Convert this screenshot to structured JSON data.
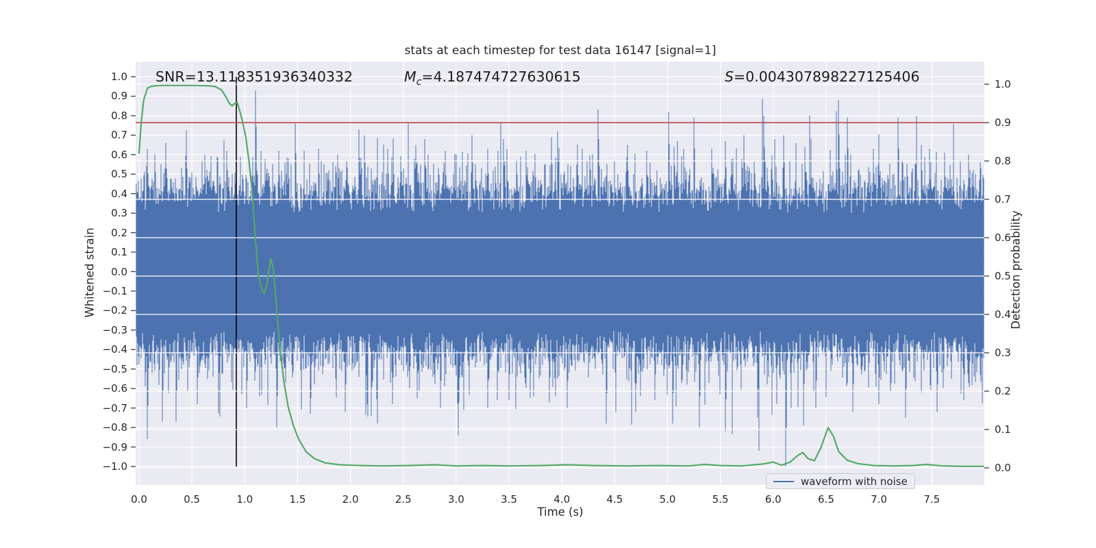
{
  "figure": {
    "background": "#ffffff"
  },
  "chart_data": {
    "type": "line",
    "title": "stats at each timestep for test data 16147 [signal=1]",
    "xlabel": "Time (s)",
    "ylabel_left": "Whitened strain",
    "ylabel_right": "Detection probability",
    "xlim": [
      -0.04,
      8.0
    ],
    "ylim_left": [
      -1.095,
      1.075
    ],
    "ylim_right": [
      -0.045,
      1.06
    ],
    "grid": true,
    "colors": {
      "waveform": "#4c72b0",
      "probability": "#55a868",
      "threshold": "#c44e52",
      "event_marker": "#000000",
      "axes_background": "#eaeaf2",
      "gridline": "#ffffff",
      "text": "#262626"
    },
    "annotations": [
      {
        "sym": "SNR",
        "sub": "",
        "eq": "=13.118351936340332",
        "italic": false
      },
      {
        "sym": "M",
        "sub": "c",
        "eq": "=4.187474727630615",
        "italic": true
      },
      {
        "sym": "S",
        "sub": "",
        "eq": "=0.004307898227125406",
        "italic": true
      }
    ],
    "x_ticks": [
      {
        "v": 0.0,
        "label": "0.0"
      },
      {
        "v": 0.5,
        "label": "0.5"
      },
      {
        "v": 1.0,
        "label": "1.0"
      },
      {
        "v": 1.5,
        "label": "1.5"
      },
      {
        "v": 2.0,
        "label": "2.0"
      },
      {
        "v": 2.5,
        "label": "2.5"
      },
      {
        "v": 3.0,
        "label": "3.0"
      },
      {
        "v": 3.5,
        "label": "3.5"
      },
      {
        "v": 4.0,
        "label": "4.0"
      },
      {
        "v": 4.5,
        "label": "4.5"
      },
      {
        "v": 5.0,
        "label": "5.0"
      },
      {
        "v": 5.5,
        "label": "5.5"
      },
      {
        "v": 6.0,
        "label": "6.0"
      },
      {
        "v": 6.5,
        "label": "6.5"
      },
      {
        "v": 7.0,
        "label": "7.0"
      },
      {
        "v": 7.5,
        "label": "7.5"
      }
    ],
    "y_ticks_left": [
      {
        "v": 1.0,
        "label": "1.0"
      },
      {
        "v": 0.9,
        "label": "0.9"
      },
      {
        "v": 0.8,
        "label": "0.8"
      },
      {
        "v": 0.7,
        "label": "0.7"
      },
      {
        "v": 0.6,
        "label": "0.6"
      },
      {
        "v": 0.5,
        "label": "0.5"
      },
      {
        "v": 0.4,
        "label": "0.4"
      },
      {
        "v": 0.3,
        "label": "0.3"
      },
      {
        "v": 0.2,
        "label": "0.2"
      },
      {
        "v": 0.1,
        "label": "0.1"
      },
      {
        "v": 0.0,
        "label": "0.0"
      },
      {
        "v": -0.1,
        "label": "−0.1"
      },
      {
        "v": -0.2,
        "label": "−0.2"
      },
      {
        "v": -0.3,
        "label": "−0.3"
      },
      {
        "v": -0.4,
        "label": "−0.4"
      },
      {
        "v": -0.5,
        "label": "−0.5"
      },
      {
        "v": -0.6,
        "label": "−0.6"
      },
      {
        "v": -0.7,
        "label": "−0.7"
      },
      {
        "v": -0.8,
        "label": "−0.8"
      },
      {
        "v": -0.9,
        "label": "−0.9"
      },
      {
        "v": -1.0,
        "label": "−1.0"
      }
    ],
    "y_ticks_right": [
      {
        "v": 1.0,
        "label": "1.0"
      },
      {
        "v": 0.9,
        "label": "0.9"
      },
      {
        "v": 0.8,
        "label": "0.8"
      },
      {
        "v": 0.7,
        "label": "0.7"
      },
      {
        "v": 0.6,
        "label": "0.6"
      },
      {
        "v": 0.5,
        "label": "0.5"
      },
      {
        "v": 0.4,
        "label": "0.4"
      },
      {
        "v": 0.3,
        "label": "0.3"
      },
      {
        "v": 0.2,
        "label": "0.2"
      },
      {
        "v": 0.1,
        "label": "0.1"
      },
      {
        "v": 0.0,
        "label": "0.0"
      }
    ],
    "threshold_line": {
      "axis": "right",
      "value": 0.9
    },
    "event_line": {
      "x": 0.92,
      "span_strain": [
        -1.0,
        1.0
      ]
    },
    "legend": {
      "entries": [
        {
          "label": "waveform with noise",
          "color": "#4c72b0"
        }
      ],
      "position": "lower right"
    },
    "series": [
      {
        "name": "waveform with noise",
        "axis": "left",
        "kind": "noise-envelope",
        "seed": 20147,
        "core_band": 0.31,
        "typical_peak": 0.52,
        "spikes_up": [
          [
            0.08,
            0.63
          ],
          [
            0.25,
            0.66
          ],
          [
            0.45,
            0.66
          ],
          [
            0.62,
            0.6
          ],
          [
            0.83,
            0.62
          ],
          [
            1.1,
            0.93
          ],
          [
            1.32,
            0.62
          ],
          [
            1.48,
            0.76
          ],
          [
            1.7,
            0.63
          ],
          [
            1.88,
            0.6
          ],
          [
            2.08,
            0.73
          ],
          [
            2.13,
            0.7
          ],
          [
            2.35,
            0.63
          ],
          [
            2.62,
            0.65
          ],
          [
            2.7,
            0.68
          ],
          [
            2.9,
            0.62
          ],
          [
            3.15,
            0.7
          ],
          [
            3.3,
            0.63
          ],
          [
            3.45,
            0.68
          ],
          [
            3.66,
            0.62
          ],
          [
            3.9,
            0.69
          ],
          [
            3.96,
            0.72
          ],
          [
            4.15,
            0.62
          ],
          [
            4.35,
            0.68
          ],
          [
            4.62,
            0.65
          ],
          [
            4.8,
            0.62
          ],
          [
            5.01,
            0.82
          ],
          [
            5.25,
            0.79
          ],
          [
            5.42,
            0.63
          ],
          [
            5.55,
            0.67
          ],
          [
            5.72,
            0.7
          ],
          [
            5.91,
            0.8
          ],
          [
            6.1,
            0.7
          ],
          [
            6.3,
            0.64
          ],
          [
            6.62,
            0.88
          ],
          [
            6.7,
            0.79
          ],
          [
            6.95,
            0.63
          ],
          [
            7.18,
            0.79
          ],
          [
            7.4,
            0.65
          ],
          [
            7.62,
            0.61
          ],
          [
            7.85,
            0.6
          ]
        ],
        "spikes_down": [
          [
            0.08,
            -0.86
          ],
          [
            0.22,
            -0.77
          ],
          [
            0.35,
            -0.77
          ],
          [
            0.55,
            -0.68
          ],
          [
            0.75,
            -0.65
          ],
          [
            1.02,
            -0.7
          ],
          [
            1.3,
            -0.8
          ],
          [
            1.62,
            -0.73
          ],
          [
            1.95,
            -0.72
          ],
          [
            2.2,
            -0.74
          ],
          [
            2.4,
            -0.68
          ],
          [
            2.63,
            -0.65
          ],
          [
            2.85,
            -0.7
          ],
          [
            3.02,
            -0.84
          ],
          [
            3.3,
            -0.7
          ],
          [
            3.5,
            -0.66
          ],
          [
            3.7,
            -0.65
          ],
          [
            4.05,
            -0.7
          ],
          [
            4.42,
            -0.78
          ],
          [
            4.7,
            -0.72
          ],
          [
            4.88,
            -0.66
          ],
          [
            5.05,
            -0.78
          ],
          [
            5.3,
            -0.8
          ],
          [
            5.55,
            -0.82
          ],
          [
            5.85,
            -0.75
          ],
          [
            6.12,
            -1.0
          ],
          [
            6.4,
            -0.7
          ],
          [
            6.75,
            -0.72
          ],
          [
            7.0,
            -0.68
          ],
          [
            7.25,
            -0.75
          ],
          [
            7.55,
            -0.72
          ],
          [
            7.8,
            -0.66
          ]
        ]
      },
      {
        "name": "detection probability",
        "axis": "right",
        "kind": "line",
        "points": [
          [
            0.0,
            0.82
          ],
          [
            0.02,
            0.9
          ],
          [
            0.045,
            0.96
          ],
          [
            0.08,
            0.99
          ],
          [
            0.12,
            0.995
          ],
          [
            0.2,
            0.997
          ],
          [
            0.35,
            0.997
          ],
          [
            0.5,
            0.997
          ],
          [
            0.65,
            0.996
          ],
          [
            0.72,
            0.994
          ],
          [
            0.78,
            0.985
          ],
          [
            0.82,
            0.968
          ],
          [
            0.855,
            0.95
          ],
          [
            0.88,
            0.944
          ],
          [
            0.905,
            0.95
          ],
          [
            0.93,
            0.952
          ],
          [
            0.955,
            0.928
          ],
          [
            0.985,
            0.895
          ],
          [
            1.01,
            0.862
          ],
          [
            1.04,
            0.8
          ],
          [
            1.07,
            0.72
          ],
          [
            1.1,
            0.6
          ],
          [
            1.13,
            0.5
          ],
          [
            1.16,
            0.465
          ],
          [
            1.185,
            0.455
          ],
          [
            1.21,
            0.478
          ],
          [
            1.245,
            0.545
          ],
          [
            1.27,
            0.52
          ],
          [
            1.3,
            0.42
          ],
          [
            1.33,
            0.32
          ],
          [
            1.37,
            0.225
          ],
          [
            1.41,
            0.16
          ],
          [
            1.46,
            0.11
          ],
          [
            1.51,
            0.075
          ],
          [
            1.58,
            0.042
          ],
          [
            1.66,
            0.024
          ],
          [
            1.76,
            0.013
          ],
          [
            1.9,
            0.008
          ],
          [
            2.1,
            0.006
          ],
          [
            2.3,
            0.005
          ],
          [
            2.55,
            0.006
          ],
          [
            2.8,
            0.008
          ],
          [
            3.0,
            0.005
          ],
          [
            3.25,
            0.006
          ],
          [
            3.5,
            0.005
          ],
          [
            3.8,
            0.006
          ],
          [
            4.05,
            0.008
          ],
          [
            4.3,
            0.006
          ],
          [
            4.6,
            0.005
          ],
          [
            4.9,
            0.006
          ],
          [
            5.2,
            0.005
          ],
          [
            5.35,
            0.009
          ],
          [
            5.5,
            0.006
          ],
          [
            5.7,
            0.005
          ],
          [
            5.9,
            0.01
          ],
          [
            6.0,
            0.015
          ],
          [
            6.08,
            0.007
          ],
          [
            6.16,
            0.015
          ],
          [
            6.23,
            0.032
          ],
          [
            6.28,
            0.04
          ],
          [
            6.33,
            0.024
          ],
          [
            6.39,
            0.019
          ],
          [
            6.45,
            0.052
          ],
          [
            6.52,
            0.105
          ],
          [
            6.57,
            0.082
          ],
          [
            6.62,
            0.042
          ],
          [
            6.7,
            0.02
          ],
          [
            6.8,
            0.011
          ],
          [
            6.95,
            0.006
          ],
          [
            7.15,
            0.005
          ],
          [
            7.32,
            0.006
          ],
          [
            7.45,
            0.009
          ],
          [
            7.6,
            0.005
          ],
          [
            7.8,
            0.004
          ],
          [
            7.99,
            0.004
          ]
        ]
      }
    ]
  }
}
